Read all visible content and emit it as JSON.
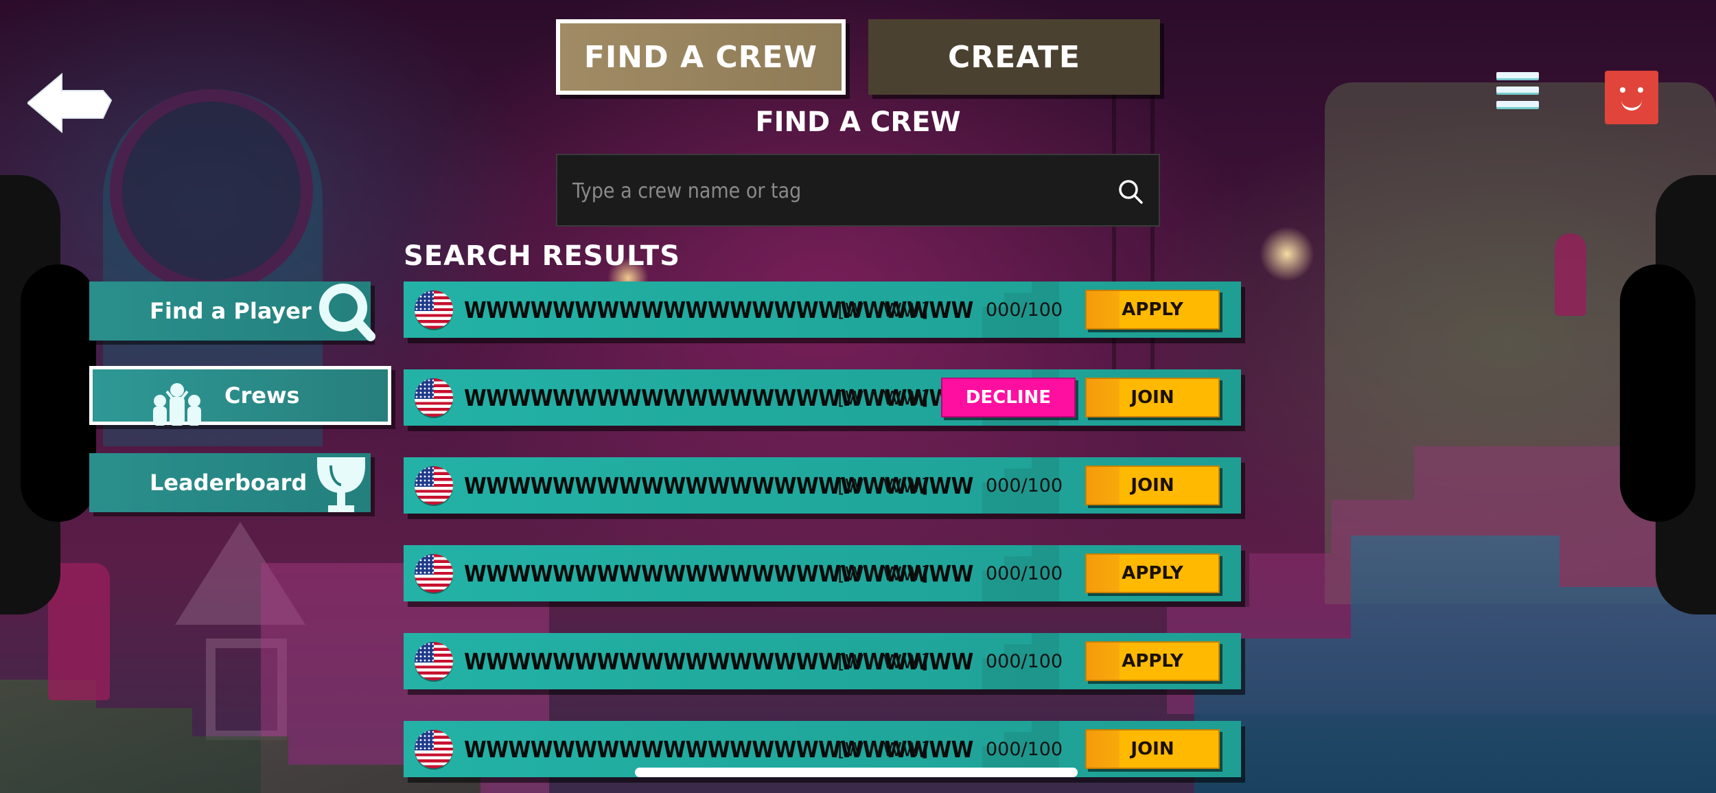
{
  "tabs": {
    "find": "FIND A CREW",
    "create": "CREATE"
  },
  "heading": "FIND A CREW",
  "search": {
    "placeholder": "Type a crew name or tag",
    "value": ""
  },
  "results_title": "SEARCH RESULTS",
  "sidebar": {
    "items": [
      {
        "label": "Find a Player",
        "icon": "magnifier-icon"
      },
      {
        "label": "Crews",
        "icon": "crew-people-icon",
        "selected": true
      },
      {
        "label": "Leaderboard",
        "icon": "trophy-icon"
      }
    ]
  },
  "results": [
    {
      "name": "WWWWWWWWWWWWWWWWWWWWWWW",
      "tag": "[WWWW]",
      "members": "000/100",
      "action": "APPLY",
      "decline": ""
    },
    {
      "name": "WWWWWWWWWWWWWWWWWWWWWWW",
      "tag": "[WWWW]",
      "members": "",
      "action": "JOIN",
      "decline": "DECLINE"
    },
    {
      "name": "WWWWWWWWWWWWWWWWWWWWWWW",
      "tag": "[WWWW]",
      "members": "000/100",
      "action": "JOIN",
      "decline": ""
    },
    {
      "name": "WWWWWWWWWWWWWWWWWWWWWWW",
      "tag": "[WWWW]",
      "members": "000/100",
      "action": "APPLY",
      "decline": ""
    },
    {
      "name": "WWWWWWWWWWWWWWWWWWWWWWW",
      "tag": "[WWWW]",
      "members": "000/100",
      "action": "APPLY",
      "decline": ""
    },
    {
      "name": "WWWWWWWWWWWWWWWWWWWWWWW",
      "tag": "[WWWW]",
      "members": "000/100",
      "action": "JOIN",
      "decline": ""
    }
  ],
  "colors": {
    "row": "#24b2a6",
    "action_button": "#ffb900",
    "decline_button": "#ff0fa0",
    "tab_active": "#a08b64",
    "tab_inactive": "#4b4130",
    "avatar": "#e0443a"
  },
  "icons": {
    "back": "back-arrow-icon",
    "menu": "hamburger-menu-icon",
    "profile": "profile-avatar-icon",
    "search": "search-icon",
    "flag": "us-flag-icon"
  }
}
